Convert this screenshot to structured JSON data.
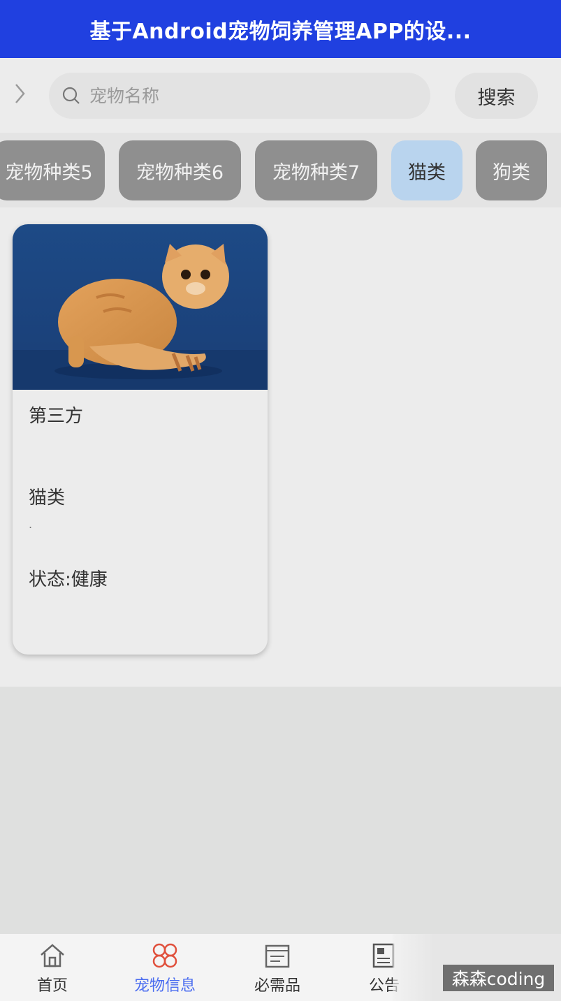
{
  "header": {
    "title": "基于Android宠物饲养管理APP的设..."
  },
  "search": {
    "placeholder": "宠物名称",
    "button_label": "搜索"
  },
  "categories": [
    {
      "label": "宠物种类5",
      "active": false
    },
    {
      "label": "宠物种类6",
      "active": false
    },
    {
      "label": "宠物种类7",
      "active": false
    },
    {
      "label": "猫类",
      "active": true
    },
    {
      "label": "狗类",
      "active": false
    }
  ],
  "pet_card": {
    "name": "第三方",
    "category": "猫类",
    "separator": ".",
    "status": "状态:健康"
  },
  "nav": {
    "items": [
      {
        "label": "首页",
        "icon": "home-icon",
        "active": false
      },
      {
        "label": "宠物信息",
        "icon": "pet-info-icon",
        "active": true
      },
      {
        "label": "必需品",
        "icon": "supplies-icon",
        "active": false
      },
      {
        "label": "公告",
        "icon": "announcement-icon",
        "active": false
      }
    ]
  },
  "watermark": "森森coding",
  "colors": {
    "header_bg": "#2040e0",
    "active_chip": "#b9d4ee",
    "inactive_chip": "#8f8f8f",
    "nav_active": "#4a6cf0",
    "nav_active_icon": "#e0503c"
  }
}
